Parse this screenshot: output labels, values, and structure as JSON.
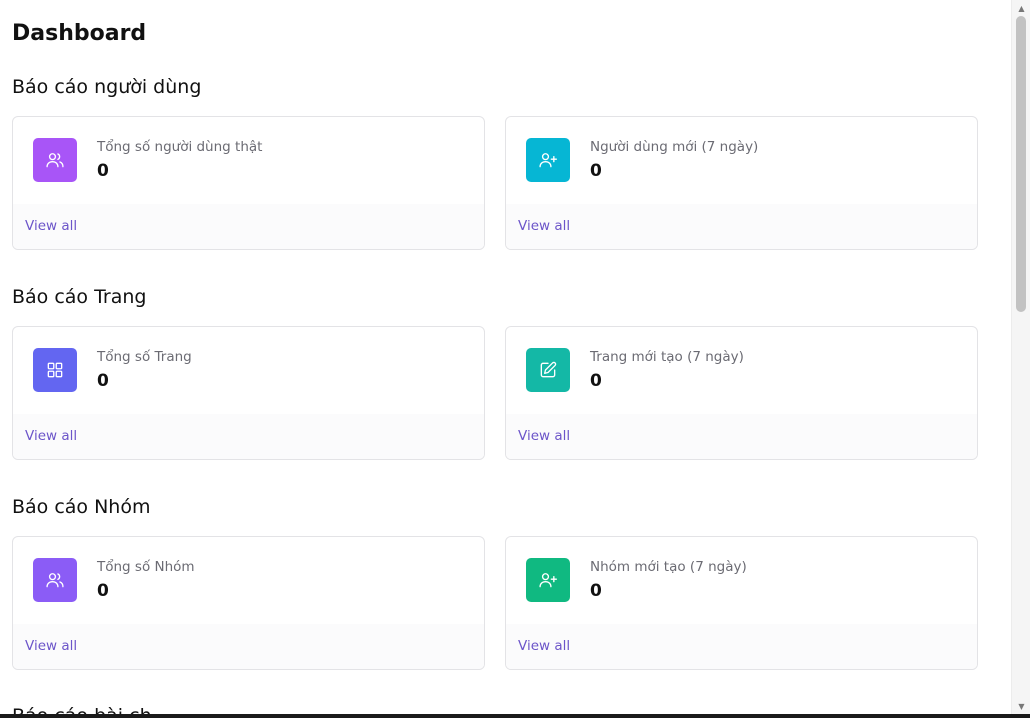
{
  "page": {
    "title": "Dashboard"
  },
  "sections": [
    {
      "title": "Báo cáo người dùng",
      "cards": [
        {
          "label": "Tổng số người dùng thật",
          "value": "0",
          "link": "View all",
          "icon": "users-icon",
          "color": "#a855f7"
        },
        {
          "label": "Người dùng mới (7 ngày)",
          "value": "0",
          "link": "View all",
          "icon": "user-plus-icon",
          "color": "#06b6d4"
        }
      ]
    },
    {
      "title": "Báo cáo Trang",
      "cards": [
        {
          "label": "Tổng số Trang",
          "value": "0",
          "link": "View all",
          "icon": "grid-icon",
          "color": "#6366f1"
        },
        {
          "label": "Trang mới tạo (7 ngày)",
          "value": "0",
          "link": "View all",
          "icon": "edit-page-icon",
          "color": "#14b8a6"
        }
      ]
    },
    {
      "title": "Báo cáo Nhóm",
      "cards": [
        {
          "label": "Tổng số Nhóm",
          "value": "0",
          "link": "View all",
          "icon": "users-icon",
          "color": "#8b5cf6"
        },
        {
          "label": "Nhóm mới tạo (7 ngày)",
          "value": "0",
          "link": "View all",
          "icon": "user-plus-icon",
          "color": "#10b981"
        }
      ]
    }
  ],
  "partial_section_title": "Báo cáo bài ch"
}
